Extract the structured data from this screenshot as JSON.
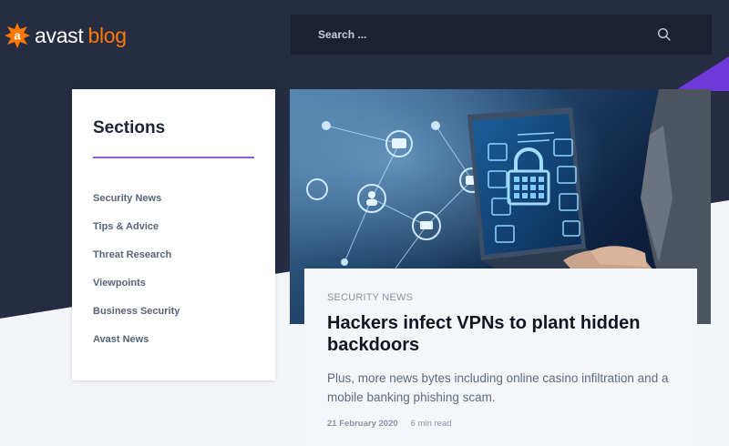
{
  "colors": {
    "header_bg": "#262c42",
    "search_bg": "#1b2033",
    "brand_orange": "#ff7800",
    "accent_purple": "#6f39d9",
    "divider_purple": "#8a5ddc",
    "page_bg": "#f3f5f9"
  },
  "logo": {
    "word": "avast",
    "suffix": "blog",
    "icon": "avast-logo-icon"
  },
  "search": {
    "placeholder": "Search ...",
    "icon": "search-icon"
  },
  "sections": {
    "title": "Sections",
    "items": [
      {
        "label": "Security News"
      },
      {
        "label": "Tips & Advice"
      },
      {
        "label": "Threat Research"
      },
      {
        "label": "Viewpoints"
      },
      {
        "label": "Business Security"
      },
      {
        "label": "Avast News"
      }
    ]
  },
  "featured": {
    "image": "vpn-laptop-padlock-illustration",
    "category": "SECURITY NEWS",
    "title": "Hackers infect VPNs to plant hidden backdoors",
    "excerpt": "Plus, more news bytes including online casino infiltration and a mobile banking phishing scam.",
    "date": "21 February 2020",
    "read_time": "6 min read"
  }
}
